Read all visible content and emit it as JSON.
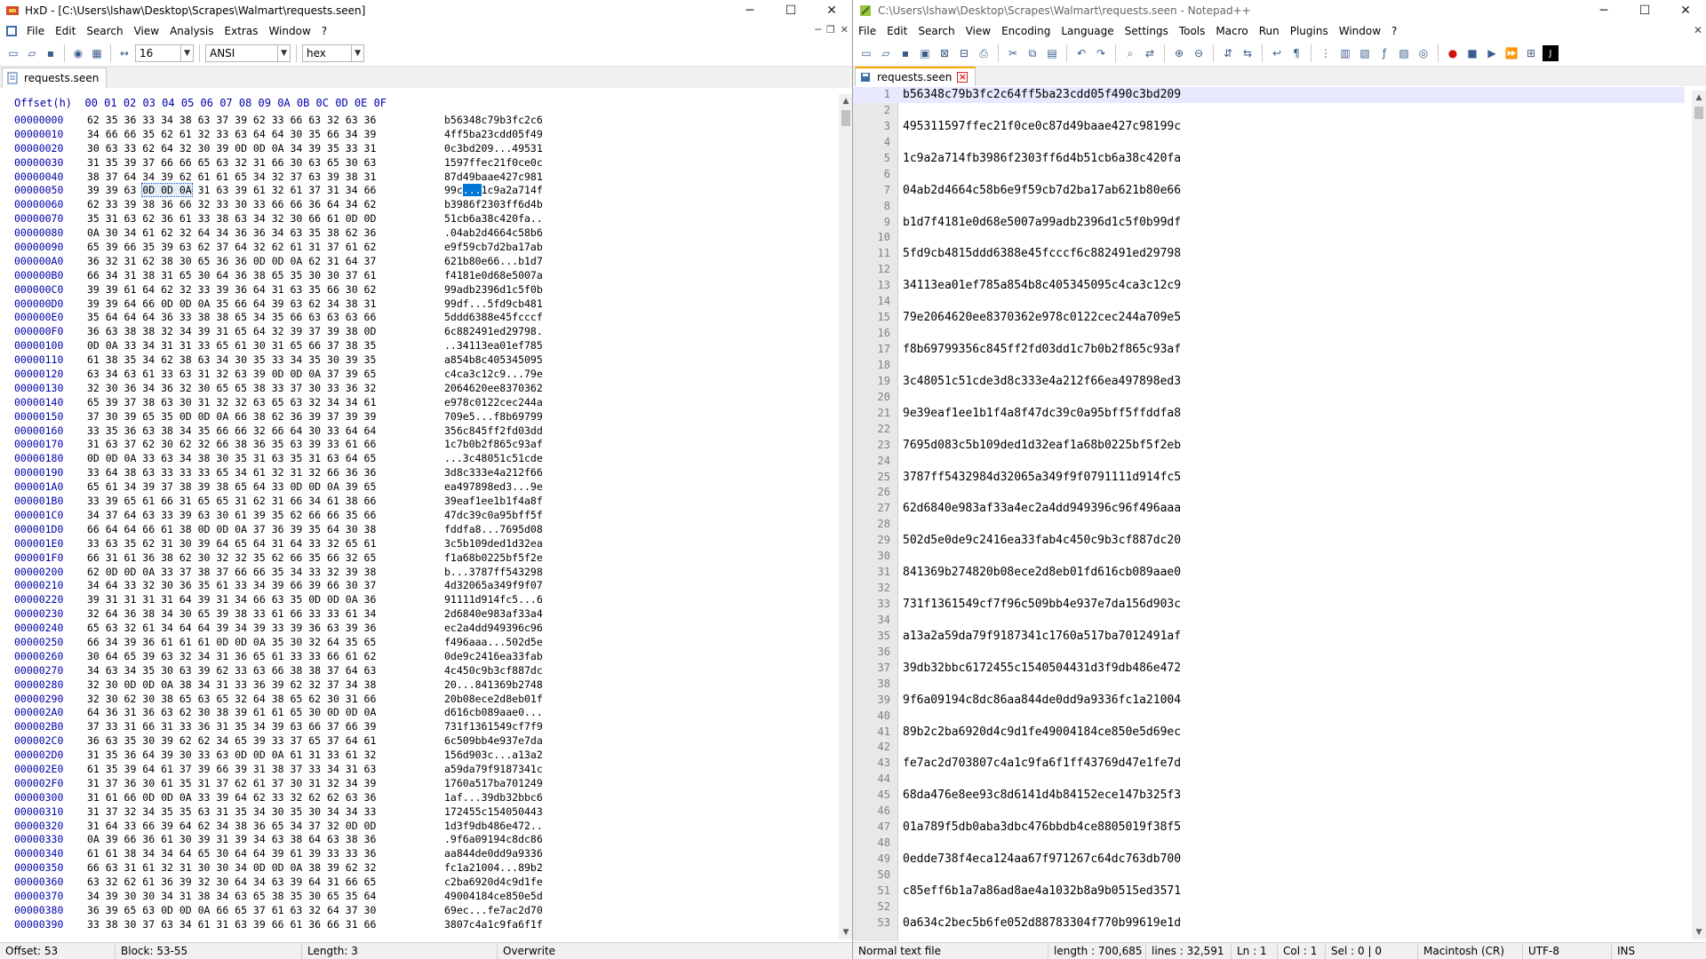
{
  "hxd": {
    "title": "HxD - [C:\\Users\\lshaw\\Desktop\\Scrapes\\Walmart\\requests.seen]",
    "menu": [
      "File",
      "Edit",
      "Search",
      "View",
      "Analysis",
      "Extras",
      "Window",
      "?"
    ],
    "toolbar": {
      "bytes_per_row": "16",
      "charset": "ANSI",
      "mode": "hex"
    },
    "tab": "requests.seen",
    "column_header": "Offset(h)  00 01 02 03 04 05 06 07 08 09 0A 0B 0C 0D 0E 0F",
    "rows": [
      {
        "off": "00000000",
        "hex": "62 35 36 33 34 38 63 37 39 62 33 66 63 32 63 36",
        "txt": "b56348c79b3fc2c6"
      },
      {
        "off": "00000010",
        "hex": "34 66 66 35 62 61 32 33 63 64 64 30 35 66 34 39",
        "txt": "4ff5ba23cdd05f49"
      },
      {
        "off": "00000020",
        "hex": "30 63 33 62 64 32 30 39 0D 0D 0A 34 39 35 33 31",
        "txt": "0c3bd209...49531"
      },
      {
        "off": "00000030",
        "hex": "31 35 39 37 66 66 65 63 32 31 66 30 63 65 30 63",
        "txt": "1597ffec21f0ce0c"
      },
      {
        "off": "00000040",
        "hex": "38 37 64 34 39 62 61 61 65 34 32 37 63 39 38 31",
        "txt": "87d49baae427c981"
      },
      {
        "off": "00000050",
        "hex_a": "39 39 63 ",
        "hex_sel": "0D 0D 0A",
        "hex_b": " 31 63 39 61 32 61 37 31 34 66",
        "txt_a": "99c",
        "txt_sel": "...",
        "txt_b": "1c9a2a714f"
      },
      {
        "off": "00000060",
        "hex": "62 33 39 38 36 66 32 33 30 33 66 66 36 64 34 62",
        "txt": "b3986f2303ff6d4b"
      },
      {
        "off": "00000070",
        "hex": "35 31 63 62 36 61 33 38 63 34 32 30 66 61 0D 0D",
        "txt": "51cb6a38c420fa.."
      },
      {
        "off": "00000080",
        "hex": "0A 30 34 61 62 32 64 34 36 36 34 63 35 38 62 36",
        "txt": ".04ab2d4664c58b6"
      },
      {
        "off": "00000090",
        "hex": "65 39 66 35 39 63 62 37 64 32 62 61 31 37 61 62",
        "txt": "e9f59cb7d2ba17ab"
      },
      {
        "off": "000000A0",
        "hex": "36 32 31 62 38 30 65 36 36 0D 0D 0A 62 31 64 37",
        "txt": "621b80e66...b1d7"
      },
      {
        "off": "000000B0",
        "hex": "66 34 31 38 31 65 30 64 36 38 65 35 30 30 37 61",
        "txt": "f4181e0d68e5007a"
      },
      {
        "off": "000000C0",
        "hex": "39 39 61 64 62 32 33 39 36 64 31 63 35 66 30 62",
        "txt": "99adb2396d1c5f0b"
      },
      {
        "off": "000000D0",
        "hex": "39 39 64 66 0D 0D 0A 35 66 64 39 63 62 34 38 31",
        "txt": "99df...5fd9cb481"
      },
      {
        "off": "000000E0",
        "hex": "35 64 64 64 36 33 38 38 65 34 35 66 63 63 63 66",
        "txt": "5ddd6388e45fcccf"
      },
      {
        "off": "000000F0",
        "hex": "36 63 38 38 32 34 39 31 65 64 32 39 37 39 38 0D",
        "txt": "6c882491ed29798."
      },
      {
        "off": "00000100",
        "hex": "0D 0A 33 34 31 31 33 65 61 30 31 65 66 37 38 35",
        "txt": "..34113ea01ef785"
      },
      {
        "off": "00000110",
        "hex": "61 38 35 34 62 38 63 34 30 35 33 34 35 30 39 35",
        "txt": "a854b8c405345095"
      },
      {
        "off": "00000120",
        "hex": "63 34 63 61 33 63 31 32 63 39 0D 0D 0A 37 39 65",
        "txt": "c4ca3c12c9...79e"
      },
      {
        "off": "00000130",
        "hex": "32 30 36 34 36 32 30 65 65 38 33 37 30 33 36 32",
        "txt": "2064620ee8370362"
      },
      {
        "off": "00000140",
        "hex": "65 39 37 38 63 30 31 32 32 63 65 63 32 34 34 61",
        "txt": "e978c0122cec244a"
      },
      {
        "off": "00000150",
        "hex": "37 30 39 65 35 0D 0D 0A 66 38 62 36 39 37 39 39",
        "txt": "709e5...f8b69799"
      },
      {
        "off": "00000160",
        "hex": "33 35 36 63 38 34 35 66 66 32 66 64 30 33 64 64",
        "txt": "356c845ff2fd03dd"
      },
      {
        "off": "00000170",
        "hex": "31 63 37 62 30 62 32 66 38 36 35 63 39 33 61 66",
        "txt": "1c7b0b2f865c93af"
      },
      {
        "off": "00000180",
        "hex": "0D 0D 0A 33 63 34 38 30 35 31 63 35 31 63 64 65",
        "txt": "...3c48051c51cde"
      },
      {
        "off": "00000190",
        "hex": "33 64 38 63 33 33 33 65 34 61 32 31 32 66 36 36",
        "txt": "3d8c333e4a212f66"
      },
      {
        "off": "000001A0",
        "hex": "65 61 34 39 37 38 39 38 65 64 33 0D 0D 0A 39 65",
        "txt": "ea497898ed3...9e"
      },
      {
        "off": "000001B0",
        "hex": "33 39 65 61 66 31 65 65 31 62 31 66 34 61 38 66",
        "txt": "39eaf1ee1b1f4a8f"
      },
      {
        "off": "000001C0",
        "hex": "34 37 64 63 33 39 63 30 61 39 35 62 66 66 35 66",
        "txt": "47dc39c0a95bff5f"
      },
      {
        "off": "000001D0",
        "hex": "66 64 64 66 61 38 0D 0D 0A 37 36 39 35 64 30 38",
        "txt": "fddfa8...7695d08"
      },
      {
        "off": "000001E0",
        "hex": "33 63 35 62 31 30 39 64 65 64 31 64 33 32 65 61",
        "txt": "3c5b109ded1d32ea"
      },
      {
        "off": "000001F0",
        "hex": "66 31 61 36 38 62 30 32 32 35 62 66 35 66 32 65",
        "txt": "f1a68b0225bf5f2e"
      },
      {
        "off": "00000200",
        "hex": "62 0D 0D 0A 33 37 38 37 66 66 35 34 33 32 39 38",
        "txt": "b...3787ff543298"
      },
      {
        "off": "00000210",
        "hex": "34 64 33 32 30 36 35 61 33 34 39 66 39 66 30 37",
        "txt": "4d32065a349f9f07"
      },
      {
        "off": "00000220",
        "hex": "39 31 31 31 31 64 39 31 34 66 63 35 0D 0D 0A 36",
        "txt": "91111d914fc5...6"
      },
      {
        "off": "00000230",
        "hex": "32 64 36 38 34 30 65 39 38 33 61 66 33 33 61 34",
        "txt": "2d6840e983af33a4"
      },
      {
        "off": "00000240",
        "hex": "65 63 32 61 34 64 64 39 34 39 33 39 36 63 39 36",
        "txt": "ec2a4dd949396c96"
      },
      {
        "off": "00000250",
        "hex": "66 34 39 36 61 61 61 0D 0D 0A 35 30 32 64 35 65",
        "txt": "f496aaa...502d5e"
      },
      {
        "off": "00000260",
        "hex": "30 64 65 39 63 32 34 31 36 65 61 33 33 66 61 62",
        "txt": "0de9c2416ea33fab"
      },
      {
        "off": "00000270",
        "hex": "34 63 34 35 30 63 39 62 33 63 66 38 38 37 64 63",
        "txt": "4c450c9b3cf887dc"
      },
      {
        "off": "00000280",
        "hex": "32 30 0D 0D 0A 38 34 31 33 36 39 62 32 37 34 38",
        "txt": "20...841369b2748"
      },
      {
        "off": "00000290",
        "hex": "32 30 62 30 38 65 63 65 32 64 38 65 62 30 31 66",
        "txt": "20b08ece2d8eb01f"
      },
      {
        "off": "000002A0",
        "hex": "64 36 31 36 63 62 30 38 39 61 61 65 30 0D 0D 0A",
        "txt": "d616cb089aae0..."
      },
      {
        "off": "000002B0",
        "hex": "37 33 31 66 31 33 36 31 35 34 39 63 66 37 66 39",
        "txt": "731f1361549cf7f9"
      },
      {
        "off": "000002C0",
        "hex": "36 63 35 30 39 62 62 34 65 39 33 37 65 37 64 61",
        "txt": "6c509bb4e937e7da"
      },
      {
        "off": "000002D0",
        "hex": "31 35 36 64 39 30 33 63 0D 0D 0A 61 31 33 61 32",
        "txt": "156d903c...a13a2"
      },
      {
        "off": "000002E0",
        "hex": "61 35 39 64 61 37 39 66 39 31 38 37 33 34 31 63",
        "txt": "a59da79f9187341c"
      },
      {
        "off": "000002F0",
        "hex": "31 37 36 30 61 35 31 37 62 61 37 30 31 32 34 39",
        "txt": "1760a517ba701249"
      },
      {
        "off": "00000300",
        "hex": "31 61 66 0D 0D 0A 33 39 64 62 33 32 62 62 63 36",
        "txt": "1af...39db32bbc6"
      },
      {
        "off": "00000310",
        "hex": "31 37 32 34 35 35 63 31 35 34 30 35 30 34 34 33",
        "txt": "172455c154050443"
      },
      {
        "off": "00000320",
        "hex": "31 64 33 66 39 64 62 34 38 36 65 34 37 32 0D 0D",
        "txt": "1d3f9db486e472.."
      },
      {
        "off": "00000330",
        "hex": "0A 39 66 36 61 30 39 31 39 34 63 38 64 63 38 36",
        "txt": ".9f6a09194c8dc86"
      },
      {
        "off": "00000340",
        "hex": "61 61 38 34 34 64 65 30 64 64 39 61 39 33 33 36",
        "txt": "aa844de0dd9a9336"
      },
      {
        "off": "00000350",
        "hex": "66 63 31 61 32 31 30 30 34 0D 0D 0A 38 39 62 32",
        "txt": "fc1a21004...89b2"
      },
      {
        "off": "00000360",
        "hex": "63 32 62 61 36 39 32 30 64 34 63 39 64 31 66 65",
        "txt": "c2ba6920d4c9d1fe"
      },
      {
        "off": "00000370",
        "hex": "34 39 30 30 34 31 38 34 63 65 38 35 30 65 35 64",
        "txt": "49004184ce850e5d"
      },
      {
        "off": "00000380",
        "hex": "36 39 65 63 0D 0D 0A 66 65 37 61 63 32 64 37 30",
        "txt": "69ec...fe7ac2d70"
      },
      {
        "off": "00000390",
        "hex": "33 38 30 37 63 34 61 31 63 39 66 61 36 66 31 66",
        "txt": "3807c4a1c9fa6f1f"
      }
    ],
    "status": {
      "offset": "Offset: 53",
      "block": "Block: 53-55",
      "length": "Length: 3",
      "mode": "Overwrite"
    }
  },
  "npp": {
    "title": "C:\\Users\\lshaw\\Desktop\\Scrapes\\Walmart\\requests.seen - Notepad++",
    "menu": [
      "File",
      "Edit",
      "Search",
      "View",
      "Encoding",
      "Language",
      "Settings",
      "Tools",
      "Macro",
      "Run",
      "Plugins",
      "Window",
      "?"
    ],
    "tab": "requests.seen",
    "lines": [
      {
        "n": "1",
        "t": "b56348c79b3fc2c64ff5ba23cdd05f490c3bd209"
      },
      {
        "n": "2",
        "t": ""
      },
      {
        "n": "3",
        "t": "495311597ffec21f0ce0c87d49baae427c98199c"
      },
      {
        "n": "4",
        "t": ""
      },
      {
        "n": "5",
        "t": "1c9a2a714fb3986f2303ff6d4b51cb6a38c420fa"
      },
      {
        "n": "6",
        "t": ""
      },
      {
        "n": "7",
        "t": "04ab2d4664c58b6e9f59cb7d2ba17ab621b80e66"
      },
      {
        "n": "8",
        "t": ""
      },
      {
        "n": "9",
        "t": "b1d7f4181e0d68e5007a99adb2396d1c5f0b99df"
      },
      {
        "n": "10",
        "t": ""
      },
      {
        "n": "11",
        "t": "5fd9cb4815ddd6388e45fcccf6c882491ed29798"
      },
      {
        "n": "12",
        "t": ""
      },
      {
        "n": "13",
        "t": "34113ea01ef785a854b8c405345095c4ca3c12c9"
      },
      {
        "n": "14",
        "t": ""
      },
      {
        "n": "15",
        "t": "79e2064620ee8370362e978c0122cec244a709e5"
      },
      {
        "n": "16",
        "t": ""
      },
      {
        "n": "17",
        "t": "f8b69799356c845ff2fd03dd1c7b0b2f865c93af"
      },
      {
        "n": "18",
        "t": ""
      },
      {
        "n": "19",
        "t": "3c48051c51cde3d8c333e4a212f66ea497898ed3"
      },
      {
        "n": "20",
        "t": ""
      },
      {
        "n": "21",
        "t": "9e39eaf1ee1b1f4a8f47dc39c0a95bff5ffddfa8"
      },
      {
        "n": "22",
        "t": ""
      },
      {
        "n": "23",
        "t": "7695d083c5b109ded1d32eaf1a68b0225bf5f2eb"
      },
      {
        "n": "24",
        "t": ""
      },
      {
        "n": "25",
        "t": "3787ff5432984d32065a349f9f0791111d914fc5"
      },
      {
        "n": "26",
        "t": ""
      },
      {
        "n": "27",
        "t": "62d6840e983af33a4ec2a4dd949396c96f496aaa"
      },
      {
        "n": "28",
        "t": ""
      },
      {
        "n": "29",
        "t": "502d5e0de9c2416ea33fab4c450c9b3cf887dc20"
      },
      {
        "n": "30",
        "t": ""
      },
      {
        "n": "31",
        "t": "841369b274820b08ece2d8eb01fd616cb089aae0"
      },
      {
        "n": "32",
        "t": ""
      },
      {
        "n": "33",
        "t": "731f1361549cf7f96c509bb4e937e7da156d903c"
      },
      {
        "n": "34",
        "t": ""
      },
      {
        "n": "35",
        "t": "a13a2a59da79f9187341c1760a517ba7012491af"
      },
      {
        "n": "36",
        "t": ""
      },
      {
        "n": "37",
        "t": "39db32bbc6172455c1540504431d3f9db486e472"
      },
      {
        "n": "38",
        "t": ""
      },
      {
        "n": "39",
        "t": "9f6a09194c8dc86aa844de0dd9a9336fc1a21004"
      },
      {
        "n": "40",
        "t": ""
      },
      {
        "n": "41",
        "t": "89b2c2ba6920d4c9d1fe49004184ce850e5d69ec"
      },
      {
        "n": "42",
        "t": ""
      },
      {
        "n": "43",
        "t": "fe7ac2d703807c4a1c9fa6f1ff43769d47e1fe7d"
      },
      {
        "n": "44",
        "t": ""
      },
      {
        "n": "45",
        "t": "68da476e8ee93c8d6141d4b84152ece147b325f3"
      },
      {
        "n": "46",
        "t": ""
      },
      {
        "n": "47",
        "t": "01a789f5db0aba3dbc476bbdb4ce8805019f38f5"
      },
      {
        "n": "48",
        "t": ""
      },
      {
        "n": "49",
        "t": "0edde738f4eca124aa67f971267c64dc763db700"
      },
      {
        "n": "50",
        "t": ""
      },
      {
        "n": "51",
        "t": "c85eff6b1a7a86ad8ae4a1032b8a9b0515ed3571"
      },
      {
        "n": "52",
        "t": ""
      },
      {
        "n": "53",
        "t": "0a634c2bec5b6fe052d88783304f770b99619e1d"
      }
    ],
    "status": {
      "type": "Normal text file",
      "length": "length : 700,685",
      "lines": "lines : 32,591",
      "ln": "Ln : 1",
      "col": "Col : 1",
      "sel": "Sel : 0 | 0",
      "eol": "Macintosh (CR)",
      "enc": "UTF-8",
      "ins": "INS"
    }
  }
}
